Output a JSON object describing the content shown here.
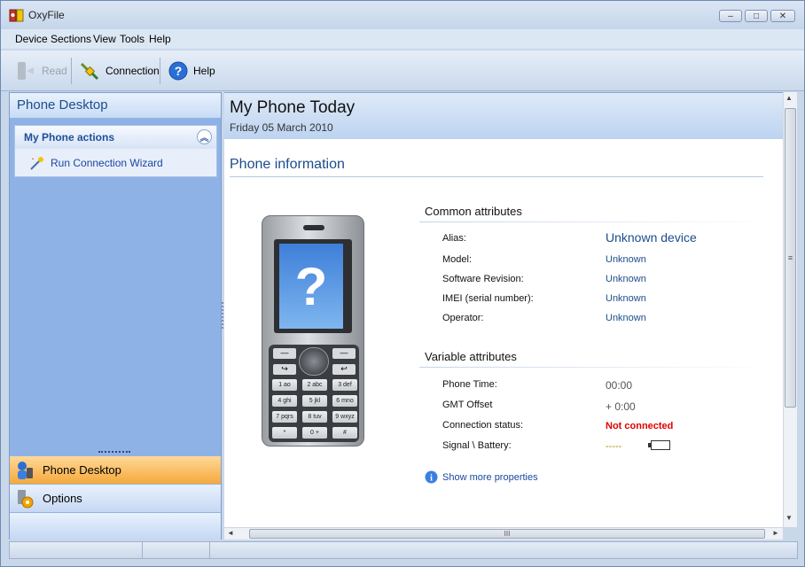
{
  "app": {
    "title": "OxyFile"
  },
  "window_controls": {
    "minimize": "–",
    "maximize": "□",
    "close": "✕"
  },
  "menu": [
    "Device",
    "Sections",
    "View",
    "Tools",
    "Help"
  ],
  "toolbar": {
    "read_label": "Read",
    "connection_label": "Connection",
    "help_label": "Help"
  },
  "sidebar": {
    "header": "Phone Desktop",
    "actions_title": "My Phone actions",
    "actions": [
      {
        "label": "Run Connection Wizard"
      }
    ],
    "nav": [
      {
        "label": "Phone Desktop",
        "active": true
      },
      {
        "label": "Options",
        "active": false
      }
    ]
  },
  "main": {
    "title": "My Phone Today",
    "date": "Friday 05 March 2010",
    "section_title": "Phone information",
    "common": {
      "title": "Common attributes",
      "rows": [
        {
          "label": "Alias:",
          "value": "Unknown device"
        },
        {
          "label": "Model:",
          "value": "Unknown"
        },
        {
          "label": "Software Revision:",
          "value": "Unknown"
        },
        {
          "label": "IMEI (serial number):",
          "value": "Unknown"
        },
        {
          "label": "Operator:",
          "value": "Unknown"
        }
      ]
    },
    "variable": {
      "title": "Variable attributes",
      "rows": [
        {
          "label": "Phone Time:",
          "value": "00:00"
        },
        {
          "label": "GMT Offset",
          "value": "+ 0:00"
        },
        {
          "label": "Connection status:",
          "value": "Not connected"
        },
        {
          "label": "Signal \\ Battery:",
          "value": "-----"
        }
      ]
    },
    "show_more": "Show more properties",
    "keypad": [
      "1 ao",
      "2 abc",
      "3 def",
      "4 ghi",
      "5 jkl",
      "6 mno",
      "7 pqrs",
      "8 tuv",
      "9 wxyz",
      "*",
      "0 +",
      "#"
    ],
    "screen_glyph": "?"
  },
  "colors": {
    "accent": "#1c4c8c",
    "error": "#e00000",
    "nav_active": "#f5a93b"
  },
  "scroll": {
    "h_grip": "III",
    "v_grip": "≡",
    "up": "▲",
    "down": "▼",
    "left": "◄",
    "right": "►"
  }
}
